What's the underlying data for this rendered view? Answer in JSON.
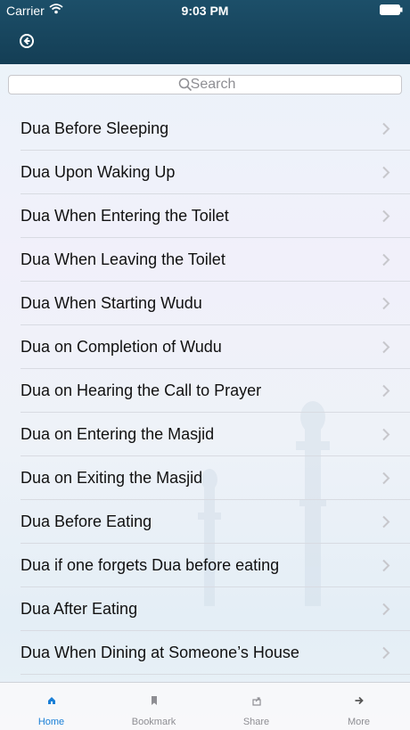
{
  "status_bar": {
    "carrier": "Carrier",
    "time": "9:03 PM"
  },
  "header": {
    "back_icon": "back-circle-icon"
  },
  "search": {
    "placeholder": "Search"
  },
  "duas": [
    {
      "label": "Dua Before Sleeping"
    },
    {
      "label": "Dua Upon Waking Up"
    },
    {
      "label": "Dua When Entering the Toilet"
    },
    {
      "label": "Dua When Leaving the Toilet"
    },
    {
      "label": "Dua When Starting Wudu"
    },
    {
      "label": "Dua on Completion of Wudu"
    },
    {
      "label": "Dua on Hearing the Call to Prayer"
    },
    {
      "label": "Dua on Entering the Masjid"
    },
    {
      "label": "Dua on Exiting the Masjid"
    },
    {
      "label": "Dua Before Eating"
    },
    {
      "label": "Dua if one forgets Dua before eating"
    },
    {
      "label": "Dua After Eating"
    },
    {
      "label": "Dua When Dining at Someone’s House"
    }
  ],
  "tabs": [
    {
      "label": "Home",
      "icon": "home-icon",
      "active": true
    },
    {
      "label": "Bookmark",
      "icon": "bookmark-icon",
      "active": false
    },
    {
      "label": "Share",
      "icon": "share-icon",
      "active": false
    },
    {
      "label": "More",
      "icon": "arrow-right-icon",
      "active": false
    }
  ],
  "colors": {
    "header": "#1c4f69",
    "accent": "#1a7fd6",
    "inactive_tab": "#8e8e93"
  }
}
